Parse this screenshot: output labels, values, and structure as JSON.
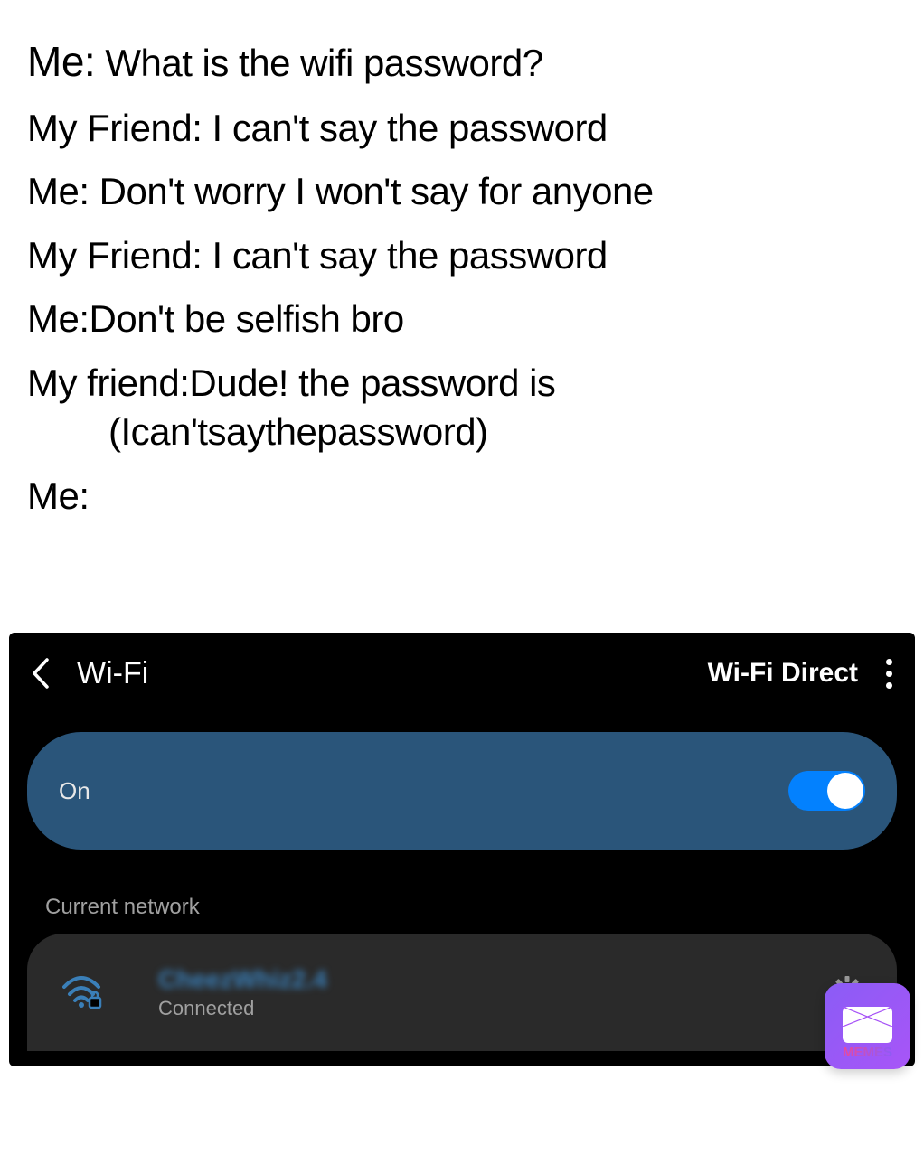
{
  "dialogue": {
    "line1_speaker": "Me:",
    "line1_text": " What is the wifi password?",
    "line2": "My Friend: I can't say the password",
    "line3": "Me: Don't worry I won't say for anyone",
    "line4": "My Friend: I can't say the password",
    "line5": "Me:Don't be selfish bro",
    "line6": "My friend:Dude! the password is",
    "line7": "(Ican'tsaythepassword)",
    "line8": "Me:"
  },
  "phone": {
    "header_title": "Wi-Fi",
    "wifi_direct": "Wi-Fi Direct",
    "toggle_label": "On",
    "section_label": "Current network",
    "network_name": "CheezWhiz2.4",
    "status": "Connected"
  },
  "badge": {
    "label": "MEMES"
  }
}
